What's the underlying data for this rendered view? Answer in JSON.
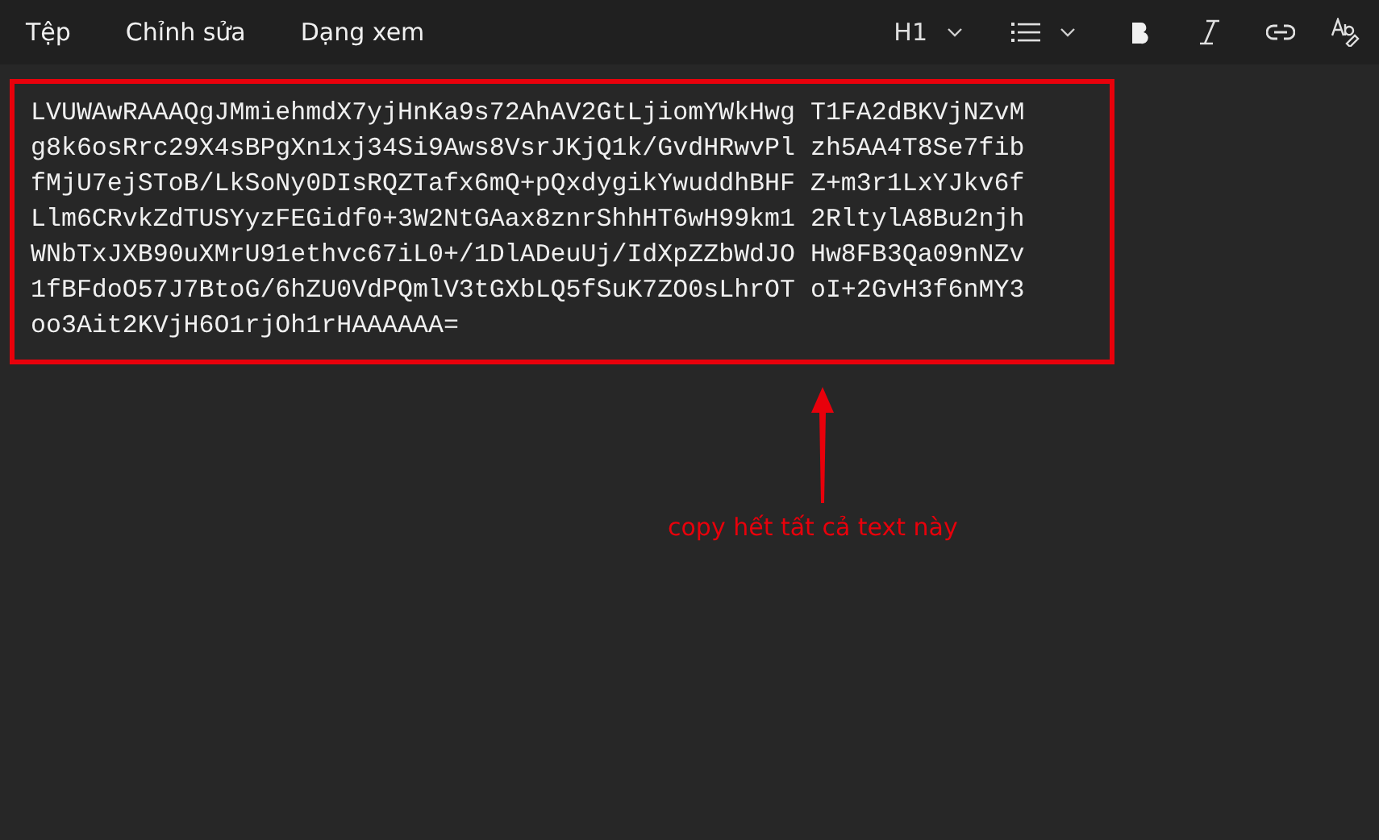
{
  "menu": [
    "Tệp",
    "Chỉnh sửa",
    "Dạng xem"
  ],
  "toolbar": {
    "heading": "H1"
  },
  "editor": {
    "lines": [
      "LVUWAwRAAAQgJMmiehmdX7yjHnKa9s72AhAV2GtLjiomYWkHwg T1FA2dBKVjNZvM",
      "g8k6osRrc29X4sBPgXn1xj34Si9Aws8VsrJKjQ1k/GvdHRwvPl zh5AA4T8Se7fib",
      "fMjU7ejSToB/LkSoNy0DIsRQZTafx6mQ+pQxdygikYwuddhBHF Z+m3r1LxYJkv6f",
      "Llm6CRvkZdTUSYyzFEGidf0+3W2NtGAax8znrShhHT6wH99km1 2RltylA8Bu2njh",
      "WNbTxJXB90uXMrU91ethvc67iL0+/1DlADeuUj/IdXpZZbWdJO Hw8FB3Qa09nNZv",
      "1fBFdoO57J7BtoG/6hZU0VdPQmlV3tGXbLQ5fSuK7ZO0sLhrOT oI+2GvH3f6nMY3",
      "oo3Ait2KVjH6O1rjOh1rHAAAAAA="
    ]
  },
  "annotation": {
    "text": "copy hết tất cả text này"
  }
}
